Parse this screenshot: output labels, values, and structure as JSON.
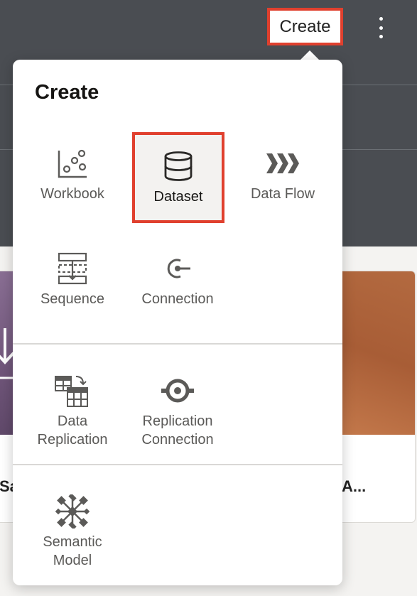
{
  "header": {
    "create_label": "Create"
  },
  "background_cards": [
    {
      "title": "Sa"
    },
    {
      "title": "A..."
    }
  ],
  "popover": {
    "title": "Create",
    "items": [
      {
        "label": "Workbook",
        "icon": "workbook-scatter-icon"
      },
      {
        "label": "Dataset",
        "icon": "database-icon",
        "selected": true
      },
      {
        "label": "Data Flow",
        "icon": "data-flow-chevrons-icon"
      },
      {
        "label": "Sequence",
        "icon": "sequence-icon"
      },
      {
        "label": "Connection",
        "icon": "connection-icon"
      },
      {
        "label": "Data\nReplication",
        "icon": "data-replication-icon"
      },
      {
        "label": "Replication\nConnection",
        "icon": "replication-connection-icon"
      },
      {
        "label": "Semantic\nModel",
        "icon": "semantic-model-icon"
      }
    ]
  },
  "colors": {
    "highlight": "#e0402e",
    "header_bg": "#4a4d52",
    "icon": "#5b5a58"
  }
}
